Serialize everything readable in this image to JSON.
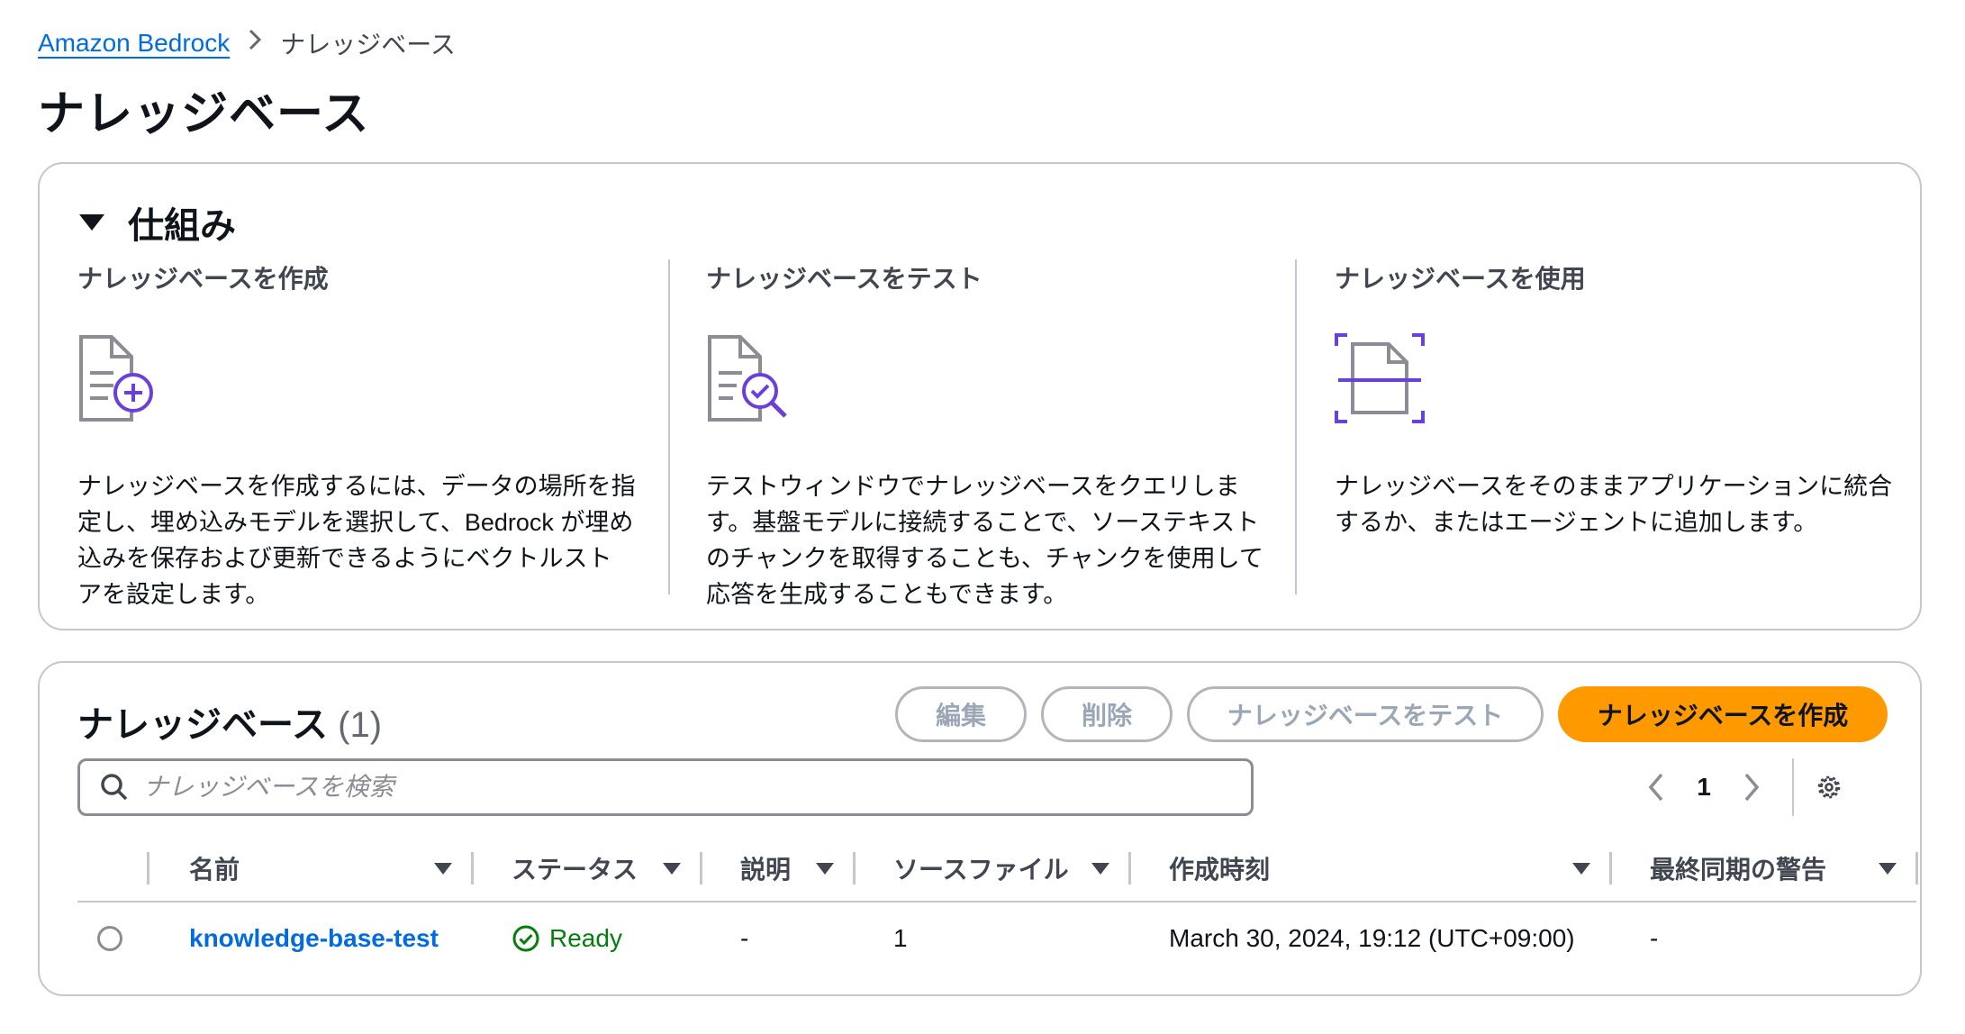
{
  "breadcrumb": {
    "root": "Amazon Bedrock",
    "current": "ナレッジベース"
  },
  "page_title": "ナレッジベース",
  "how_it_works": {
    "title": "仕組み",
    "columns": [
      {
        "heading": "ナレッジベースを作成",
        "icon": "document-add-icon",
        "text": "ナレッジベースを作成するには、データの場所を指定し、埋め込みモデルを選択して、Bedrock が埋め込みを保存および更新できるようにベクトルストアを設定します。"
      },
      {
        "heading": "ナレッジベースをテスト",
        "icon": "document-search-icon",
        "text": "テストウィンドウでナレッジベースをクエリします。基盤モデルに接続することで、ソーステキストのチャンクを取得することも、チャンクを使用して応答を生成することもできます。"
      },
      {
        "heading": "ナレッジベースを使用",
        "icon": "document-scan-icon",
        "text": "ナレッジベースをそのままアプリケーションに統合するか、またはエージェントに追加します。"
      }
    ]
  },
  "kb_table": {
    "title": "ナレッジベース",
    "count": "(1)",
    "buttons": {
      "edit": "編集",
      "delete": "削除",
      "test": "ナレッジベースをテスト",
      "create": "ナレッジベースを作成"
    },
    "search_placeholder": "ナレッジベースを検索",
    "page": "1",
    "columns": [
      "名前",
      "ステータス",
      "説明",
      "ソースファイル",
      "作成時刻",
      "最終同期の警告"
    ],
    "rows": [
      {
        "name": "knowledge-base-test",
        "status": "Ready",
        "description": "-",
        "source_files": "1",
        "created": "March 30, 2024, 19:12 (UTC+09:00)",
        "last_sync_warning": "-"
      }
    ]
  },
  "colors": {
    "link": "#006ce0",
    "primary_button": "#ff9900",
    "success": "#037f0c",
    "accent_purple": "#6b40d8"
  }
}
